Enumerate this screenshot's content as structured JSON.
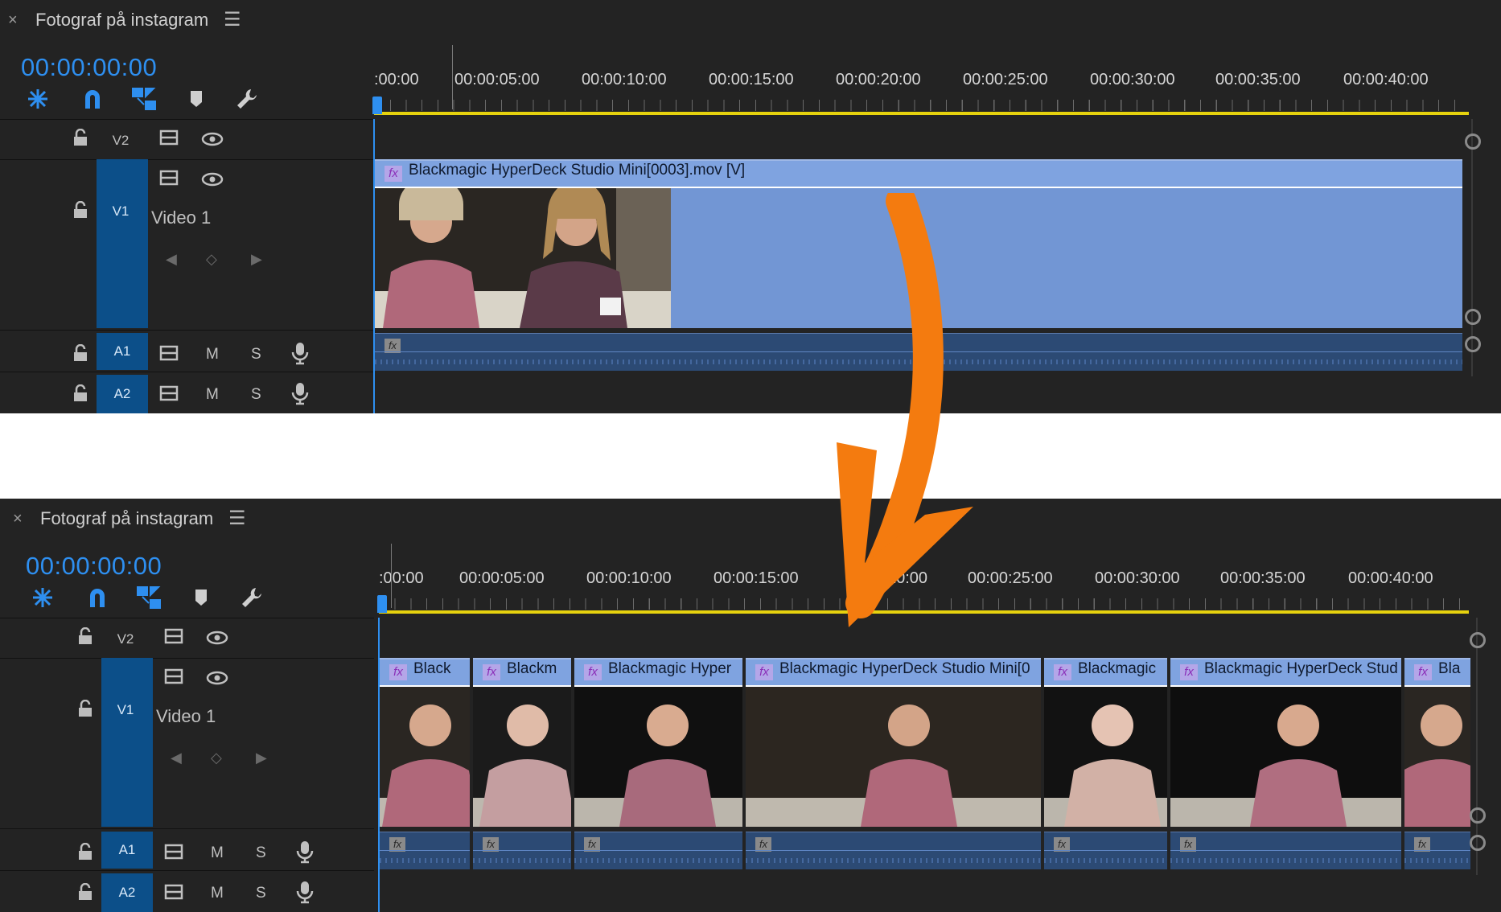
{
  "sequence_title": "Fotograf på instagram",
  "timecode": "00:00:00:00",
  "ruler": {
    "labels_top": [
      ":00:00",
      "00:00:05:00",
      "00:00:10:00",
      "00:00:15:00",
      "00:00:20:00",
      "00:00:25:00",
      "00:00:30:00",
      "00:00:35:00",
      "00:00:40:00"
    ],
    "labels_bottom": [
      ":00:00",
      "00:00:05:00",
      "00:00:10:00",
      "00:00:15:00",
      "20:00",
      "00:00:25:00",
      "00:00:30:00",
      "00:00:35:00",
      "00:00:40:00"
    ]
  },
  "tracks": {
    "v2": "V2",
    "v1": "V1",
    "v1_name": "Video 1",
    "a1": "A1",
    "a2": "A2",
    "mute": "M",
    "solo": "S"
  },
  "top_clip": {
    "fx": "fx",
    "name": "Blackmagic HyperDeck Studio Mini[0003].mov [V]"
  },
  "bottom_clips": [
    {
      "name": "Black"
    },
    {
      "name": "Blackm"
    },
    {
      "name": "Blackmagic Hyper"
    },
    {
      "name": "Blackmagic HyperDeck Studio Mini[0"
    },
    {
      "name": "Blackmagic"
    },
    {
      "name": "Blackmagic HyperDeck Stud"
    },
    {
      "name": "Bla"
    }
  ],
  "icons": {
    "close": "×",
    "menu": "☰"
  },
  "colors": {
    "accent_blue": "#2e8ff0",
    "clip_blue": "#7296d4",
    "audio_blue": "#2c4a74",
    "playbar_yellow": "#e6d20e",
    "arrow_orange": "#f47b0f"
  }
}
